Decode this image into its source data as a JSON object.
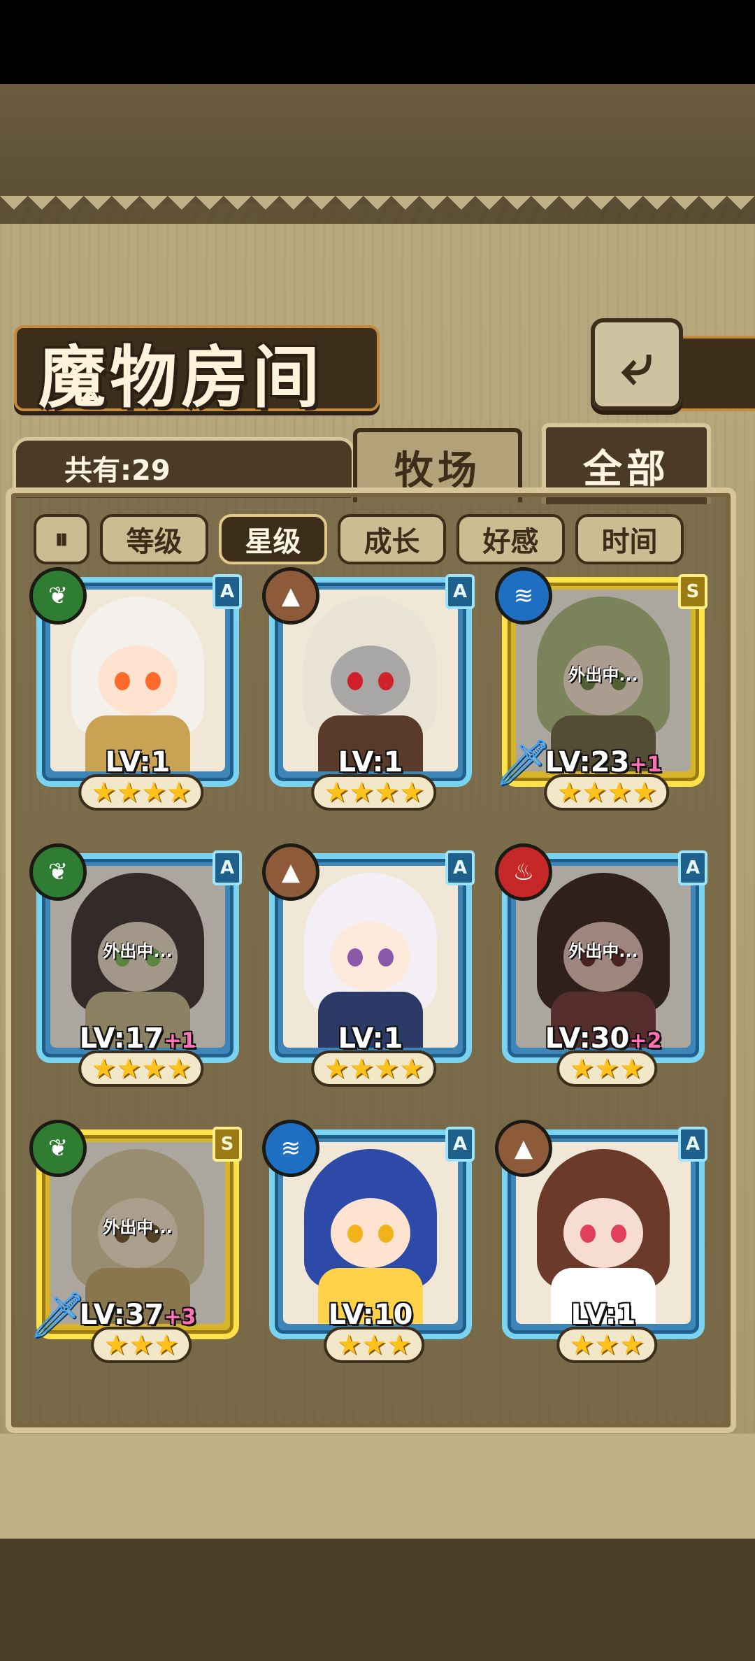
{
  "header": {
    "title": "魔物房间",
    "back_icon": "return-arrow-icon"
  },
  "summary": {
    "count_label": "共有:29"
  },
  "tabs": [
    {
      "label": "牧场",
      "active": false
    },
    {
      "label": "全部",
      "active": true
    }
  ],
  "sort": {
    "toggle_icon": "pause-order-icon",
    "buttons": [
      {
        "label": "等级",
        "active": false
      },
      {
        "label": "星级",
        "active": true
      },
      {
        "label": "成长",
        "active": false
      },
      {
        "label": "好感",
        "active": false
      },
      {
        "label": "时间",
        "active": false
      }
    ]
  },
  "monsters": [
    {
      "element": "grass",
      "rank": "A",
      "level": "LV:1",
      "plus": "",
      "stars": "★★★★",
      "away": "",
      "frame": "blue",
      "equip": false
    },
    {
      "element": "earth",
      "rank": "A",
      "level": "LV:1",
      "plus": "",
      "stars": "★★★★",
      "away": "",
      "frame": "blue",
      "equip": false
    },
    {
      "element": "water",
      "rank": "S",
      "level": "LV:23",
      "plus": "+1",
      "stars": "★★★★",
      "away": "外出中...",
      "frame": "gold",
      "equip": true
    },
    {
      "element": "grass",
      "rank": "A",
      "level": "LV:17",
      "plus": "+1",
      "stars": "★★★★",
      "away": "外出中...",
      "frame": "blue",
      "equip": false
    },
    {
      "element": "earth",
      "rank": "A",
      "level": "LV:1",
      "plus": "",
      "stars": "★★★★",
      "away": "",
      "frame": "blue",
      "equip": false
    },
    {
      "element": "fire",
      "rank": "A",
      "level": "LV:30",
      "plus": "+2",
      "stars": "★★★",
      "away": "外出中...",
      "frame": "blue",
      "equip": false
    },
    {
      "element": "grass",
      "rank": "S",
      "level": "LV:37",
      "plus": "+3",
      "stars": "★★★",
      "away": "外出中...",
      "frame": "gold",
      "equip": true
    },
    {
      "element": "water",
      "rank": "A",
      "level": "LV:10",
      "plus": "",
      "stars": "★★★",
      "away": "",
      "frame": "blue",
      "equip": false
    },
    {
      "element": "earth",
      "rank": "A",
      "level": "LV:1",
      "plus": "",
      "stars": "★★★",
      "away": "",
      "frame": "blue",
      "equip": false
    }
  ],
  "colors": {
    "blue_frame": "#7ad3f0",
    "gold_frame": "#ffe14a",
    "plus_level": "#ff6fb4",
    "panel": "#b8a97e"
  }
}
